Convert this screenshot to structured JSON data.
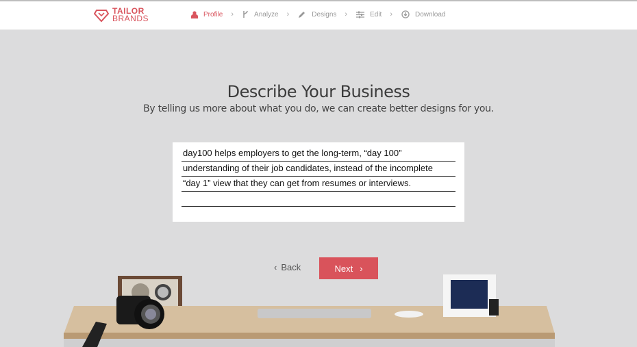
{
  "header": {
    "logo": {
      "line1": "TAILOR",
      "line2": "BRANDS"
    },
    "steps": [
      {
        "label": "Profile",
        "icon": "user-icon",
        "active": true
      },
      {
        "label": "Analyze",
        "icon": "fork-icon",
        "active": false
      },
      {
        "label": "Designs",
        "icon": "pencil-icon",
        "active": false
      },
      {
        "label": "Edit",
        "icon": "sliders-icon",
        "active": false
      },
      {
        "label": "Download",
        "icon": "download-icon",
        "active": false
      }
    ],
    "accent": "#d9545d"
  },
  "main": {
    "title": "Describe Your Business",
    "subtitle": "By telling us more about what you do, we can create better designs for you.",
    "description_lines": [
      "day100 helps employers to get the long-term, “day 100”",
      "understanding of their job candidates, instead of the incomplete",
      "“day 1” view that they can get from resumes or interviews.",
      ""
    ],
    "back_label": "Back",
    "next_label": "Next"
  }
}
